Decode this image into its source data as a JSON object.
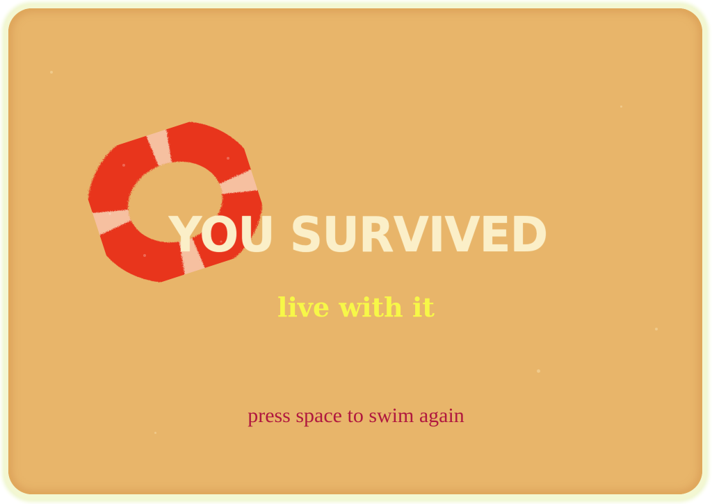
{
  "screen": {
    "title": "YOU SURVIVED",
    "subtitle": "live with it",
    "prompt": "press space to swim again"
  },
  "icons": {
    "life_ring": "life-ring-icon"
  },
  "colors": {
    "background": "#e8b56a",
    "border": "#f3f7d2",
    "title": "#fbefc8",
    "subtitle": "#f7f748",
    "prompt": "#b0183f",
    "ring_red": "#e8341f",
    "ring_stripe": "#f6c0a0"
  }
}
